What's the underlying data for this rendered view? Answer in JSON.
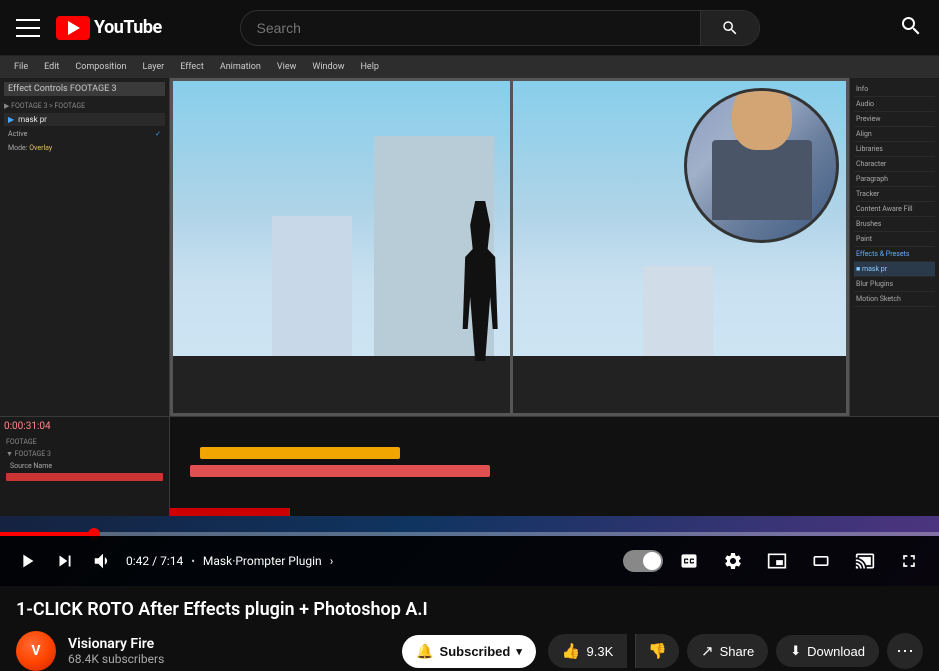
{
  "header": {
    "menu_label": "Menu",
    "logo_text": "YouTube",
    "search_placeholder": "Search",
    "search_button_label": "Search"
  },
  "video": {
    "current_time": "0:42",
    "total_time": "7:14",
    "chapter": "Mask·Prompter Plugin",
    "progress_percent": 10,
    "autoplay_on": true,
    "captions_label": "Captions",
    "settings_label": "Settings",
    "miniplayer_label": "Miniplayer",
    "theater_label": "Theater mode",
    "cast_label": "Cast",
    "fullscreen_label": "Fullscreen"
  },
  "page": {
    "title": "1-CLICK ROTO After Effects plugin + Photoshop A.I"
  },
  "channel": {
    "name": "Visionary Fire",
    "subscribers": "68.4K subscribers",
    "avatar_letter": "V"
  },
  "actions": {
    "subscribe_label": "Subscribed",
    "like_count": "9.3K",
    "like_label": "Like",
    "dislike_label": "Dislike",
    "share_label": "Share",
    "download_label": "Download",
    "more_label": "More"
  }
}
